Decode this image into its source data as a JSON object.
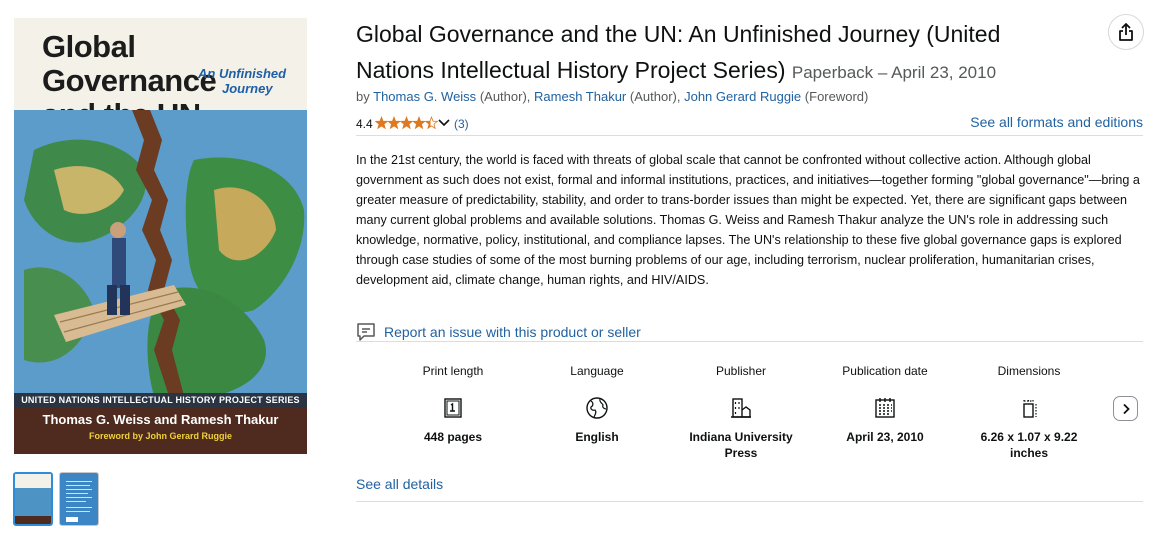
{
  "cover": {
    "title_line1": "Global Governance",
    "title_line2": "and the UN",
    "subtitle_line1": "An Unfinished",
    "subtitle_line2": "Journey",
    "series": "UNITED NATIONS INTELLECTUAL HISTORY PROJECT SERIES",
    "authors": "Thomas G. Weiss and Ramesh Thakur",
    "foreword": "Foreword by John Gerard Ruggie"
  },
  "thumbnails": [
    {
      "name": "front-cover",
      "selected": true
    },
    {
      "name": "back-cover",
      "selected": false
    }
  ],
  "product": {
    "title": "Global Governance and the UN: An Unfinished Journey (United Nations Intellectual History Project Series)",
    "format": "Paperback – April 23, 2010",
    "byline": {
      "by": "by",
      "contributors": [
        {
          "name": "Thomas G. Weiss",
          "role": "(Author),"
        },
        {
          "name": "Ramesh Thakur",
          "role": "(Author),"
        },
        {
          "name": "John Gerard Ruggie",
          "role": "(Foreword)"
        }
      ]
    },
    "rating": {
      "value": "4.4",
      "stars": 4.4,
      "count": "(3)"
    },
    "see_all_formats": "See all formats and editions",
    "description": "In the 21st century, the world is faced with threats of global scale that cannot be confronted without collective action. Although global government as such does not exist, formal and informal institutions, practices, and initiatives—together forming \"global governance\"—bring a greater measure of predictability, stability, and order to trans-border issues than might be expected. Yet, there are significant gaps between many current global problems and available solutions. Thomas G. Weiss and Ramesh Thakur analyze the UN's role in addressing such knowledge, normative, policy, institutional, and compliance lapses. The UN's relationship to these five global governance gaps is explored through case studies of some of the most burning problems of our age, including terrorism, nuclear proliferation, humanitarian crises, development aid, climate change, human rights, and HIV/AIDS.",
    "report_link": "Report an issue with this product or seller",
    "details": [
      {
        "label": "Print length",
        "value": "448 pages",
        "icon": "book-pages-icon"
      },
      {
        "label": "Language",
        "value": "English",
        "icon": "globe-icon"
      },
      {
        "label": "Publisher",
        "value": "Indiana University Press",
        "icon": "building-icon"
      },
      {
        "label": "Publication date",
        "value": "April 23, 2010",
        "icon": "calendar-icon"
      },
      {
        "label": "Dimensions",
        "value": "6.26 x 1.07 x 9.22 inches",
        "icon": "ruler-icon"
      }
    ],
    "see_all_details": "See all details"
  },
  "colors": {
    "link": "#2162a1",
    "star": "#de7921",
    "text": "#0f1111",
    "muted": "#565959"
  }
}
